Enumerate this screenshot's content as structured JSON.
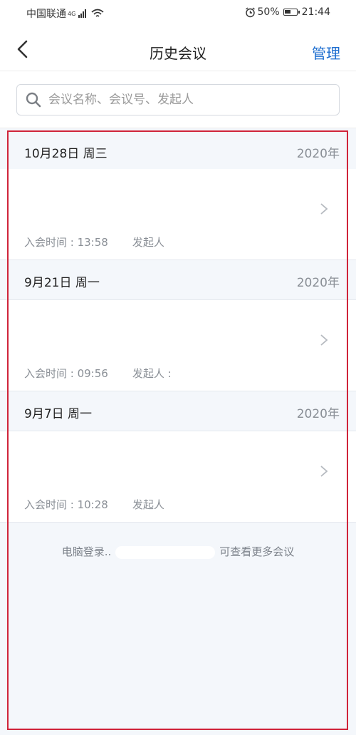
{
  "status_bar": {
    "carrier": "中国联通",
    "network": "4G",
    "battery": "50%",
    "time": "21:44"
  },
  "nav": {
    "title": "历史会议",
    "manage_label": "管理"
  },
  "search": {
    "placeholder": "会议名称、会议号、发起人",
    "value": ""
  },
  "groups": [
    {
      "date": "10月28日 周三",
      "year": "2020年",
      "meetings": [
        {
          "title": "",
          "join_time": "入会时间 : 13:58",
          "creator": "发起人"
        }
      ]
    },
    {
      "date": "9月21日 周一",
      "year": "2020年",
      "meetings": [
        {
          "title": "",
          "join_time": "入会时间 : 09:56",
          "creator": "发起人 :"
        }
      ]
    },
    {
      "date": "9月7日 周一",
      "year": "2020年",
      "meetings": [
        {
          "title": "",
          "join_time": "入会时间 : 10:28",
          "creator": "发起人"
        }
      ]
    }
  ],
  "footer": {
    "prefix": "电脑登录..",
    "suffix": "可查看更多会议"
  },
  "colors": {
    "accent": "#1f6fd0",
    "list_bg": "#f4f7fb",
    "frame": "#d0243a"
  }
}
